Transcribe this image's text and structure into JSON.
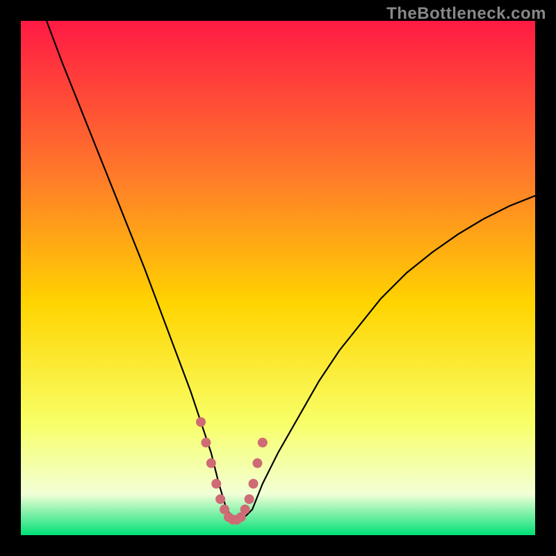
{
  "watermark": "TheBottleneck.com",
  "colors": {
    "bg": "#000000",
    "grad_top": "#ff1a44",
    "grad_mid1": "#ff7a2a",
    "grad_mid2": "#ffd400",
    "grad_mid3": "#f8ff66",
    "grad_low": "#f2ffd6",
    "grad_bottom": "#00e076",
    "curve": "#000000",
    "marker_fill": "#ce6b74",
    "marker_stroke": "#a84f58"
  },
  "chart_data": {
    "type": "line",
    "title": "",
    "xlabel": "",
    "ylabel": "",
    "xlim": [
      0,
      100
    ],
    "ylim": [
      0,
      100
    ],
    "series": [
      {
        "name": "bottleneck-curve",
        "x": [
          5,
          8,
          12,
          16,
          20,
          24,
          27,
          30,
          33,
          35,
          37,
          38.5,
          40,
          41.5,
          43,
          45,
          47,
          50,
          54,
          58,
          62,
          66,
          70,
          75,
          80,
          85,
          90,
          95,
          100
        ],
        "y": [
          100,
          92,
          82,
          72,
          62,
          52,
          44,
          36,
          28,
          22,
          16,
          10,
          5,
          3,
          3,
          5,
          10,
          16,
          23,
          30,
          36,
          41,
          46,
          51,
          55,
          58.5,
          61.5,
          64,
          66
        ]
      }
    ],
    "markers": {
      "name": "highlight-range",
      "x_start": 35,
      "x_end": 47,
      "points_x": [
        35,
        36,
        37,
        38,
        38.8,
        39.6,
        40.4,
        41.2,
        42,
        42.8,
        43.6,
        44.4,
        45.2,
        46,
        47
      ],
      "points_y": [
        22,
        18,
        14,
        10,
        7,
        5,
        3.5,
        3,
        3,
        3.5,
        5,
        7,
        10,
        14,
        18
      ]
    }
  }
}
